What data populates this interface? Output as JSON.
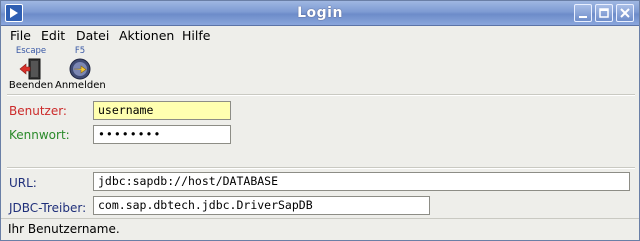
{
  "window": {
    "title": "Login"
  },
  "menu": {
    "items": [
      "File",
      "Edit",
      "Datei",
      "Aktionen",
      "Hilfe"
    ]
  },
  "toolbar": {
    "beenden": {
      "key": "Escape",
      "label": "Beenden",
      "icon": "exit-door-icon"
    },
    "anmelden": {
      "key": "F5",
      "label": "Anmelden",
      "icon": "login-arrow-icon"
    }
  },
  "form": {
    "benutzer": {
      "label": "Benutzer:",
      "value": "username"
    },
    "kennwort": {
      "label": "Kennwort:",
      "value": "••••••••"
    },
    "url": {
      "label": "URL:",
      "value": "jdbc:sapdb://host/DATABASE"
    },
    "treiber": {
      "label": "JDBC-Treiber:",
      "value": "com.sap.dbtech.jdbc.DriverSapDB"
    }
  },
  "status": {
    "text": "Ihr Benutzername."
  },
  "colors": {
    "titlebar": "#7e9bd3",
    "required_label": "#cc2a2a",
    "password_label": "#2a8a2a",
    "active_field": "#ffffb0"
  }
}
